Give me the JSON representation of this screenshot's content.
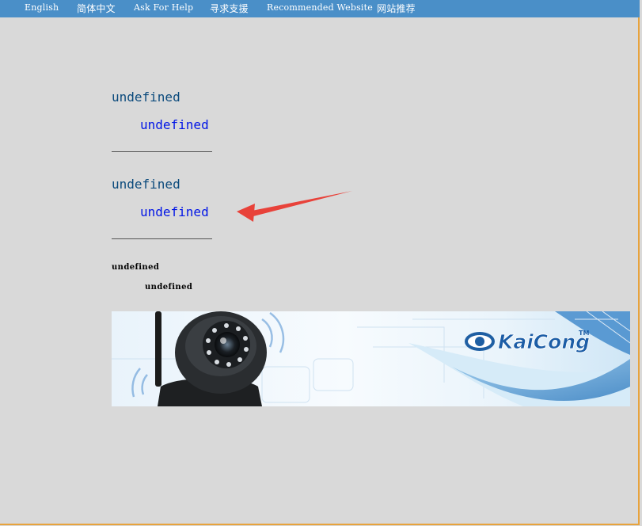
{
  "nav": {
    "items": [
      {
        "label": "English"
      },
      {
        "label": "简体中文"
      },
      {
        "label": "Ask For Help"
      },
      {
        "label": "寻求支援"
      },
      {
        "label": "Recommended Website"
      },
      {
        "label": "网站推荐"
      }
    ]
  },
  "content": {
    "section1": {
      "heading": "undefined",
      "link": "undefined"
    },
    "section2": {
      "heading": "undefined",
      "link": "undefined"
    },
    "section3": {
      "heading": "undefined",
      "link": "undefined"
    }
  },
  "banner": {
    "brand": "KaiCong",
    "trademark": "TM"
  },
  "colors": {
    "nav_bg": "#4a8fc8",
    "page_bg": "#d9d9d9",
    "heading": "#0b4a7c",
    "link": "#0014e6",
    "arrow": "#e8423a"
  }
}
